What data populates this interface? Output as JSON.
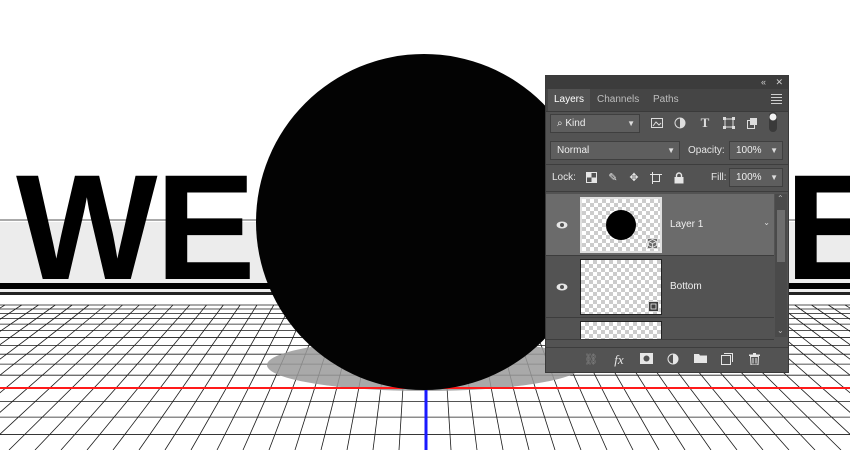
{
  "canvas": {
    "letters_left": "WE",
    "letters_right": "E",
    "colors": {
      "guide_horizontal": "#ff0000",
      "guide_vertical": "#0000ff",
      "shape": "#000000"
    }
  },
  "panel": {
    "collapse_glyph": "«",
    "close_glyph": "✕",
    "tabs": [
      {
        "label": "Layers",
        "active": true
      },
      {
        "label": "Channels",
        "active": false
      },
      {
        "label": "Paths",
        "active": false
      }
    ],
    "filter": {
      "kind_label": "Kind"
    },
    "blend_mode": "Normal",
    "opacity_label": "Opacity:",
    "opacity_value": "100%",
    "lock_label": "Lock:",
    "fill_label": "Fill:",
    "fill_value": "100%",
    "layers": [
      {
        "name": "Layer 1",
        "selected": true,
        "visible": true,
        "badge_icon": "3d-cube-icon"
      },
      {
        "name": "Bottom",
        "selected": false,
        "visible": true,
        "badge_icon": "artboard-icon"
      }
    ],
    "bottom_icons": [
      "link-icon",
      "fx-icon",
      "mask-icon",
      "adjustment-icon",
      "group-folder-icon",
      "new-layer-icon",
      "trash-icon"
    ],
    "fx_label": "fx"
  }
}
